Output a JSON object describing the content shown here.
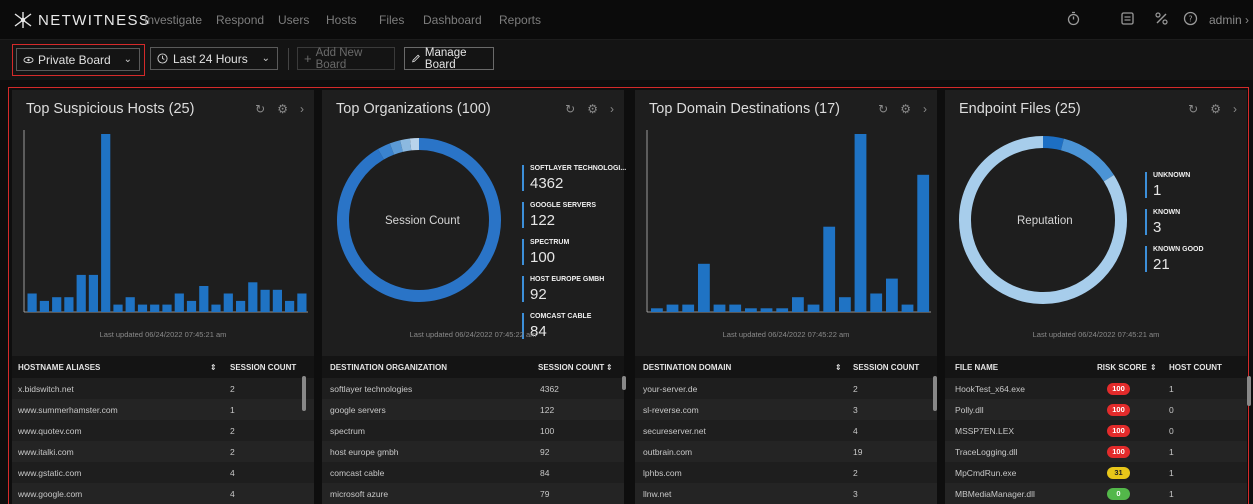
{
  "brand": {
    "name": "NETWITNESS"
  },
  "nav": {
    "items": [
      "Investigate",
      "Respond",
      "Users",
      "Hosts",
      "Files",
      "Dashboard",
      "Reports"
    ],
    "user": "admin"
  },
  "toolbar": {
    "board_label": "Private Board",
    "time_label": "Last 24 Hours",
    "add_label": "Add New Board",
    "manage_label": "Manage Board"
  },
  "colors": {
    "accent": "#1f73c4",
    "highlight": "#d42a2a",
    "panel": "#1e1e1e"
  },
  "dashlets": [
    {
      "title": "Top Suspicious Hosts (25)",
      "updated": "Last updated 06/24/2022 07:45:21 am",
      "columns": [
        "HOSTNAME ALIASES",
        "SESSION COUNT"
      ],
      "rows": [
        [
          "x.bidswitch.net",
          "2"
        ],
        [
          "www.summerhamster.com",
          "1"
        ],
        [
          "www.quotev.com",
          "2"
        ],
        [
          "www.italki.com",
          "2"
        ],
        [
          "www.gstatic.com",
          "4"
        ],
        [
          "www.google.com",
          "4"
        ]
      ]
    },
    {
      "title": "Top Organizations (100)",
      "updated": "Last updated 06/24/2022 07:45:22 am",
      "center_label": "Session Count",
      "legend": [
        {
          "name": "SOFTLAYER TECHNOLOGI...",
          "value": "4362"
        },
        {
          "name": "GOOGLE SERVERS",
          "value": "122"
        },
        {
          "name": "SPECTRUM",
          "value": "100"
        },
        {
          "name": "HOST EUROPE GMBH",
          "value": "92"
        },
        {
          "name": "COMCAST CABLE",
          "value": "84"
        }
      ],
      "columns": [
        "DESTINATION ORGANIZATION",
        "SESSION COUNT"
      ],
      "rows": [
        [
          "softlayer technologies",
          "4362"
        ],
        [
          "google servers",
          "122"
        ],
        [
          "spectrum",
          "100"
        ],
        [
          "host europe gmbh",
          "92"
        ],
        [
          "comcast cable",
          "84"
        ],
        [
          "microsoft azure",
          "79"
        ]
      ]
    },
    {
      "title": "Top Domain Destinations (17)",
      "updated": "Last updated 06/24/2022 07:45:22 am",
      "columns": [
        "DESTINATION DOMAIN",
        "SESSION COUNT"
      ],
      "rows": [
        [
          "your-server.de",
          "2"
        ],
        [
          "sl-reverse.com",
          "3"
        ],
        [
          "secureserver.net",
          "4"
        ],
        [
          "outbrain.com",
          "19"
        ],
        [
          "lphbs.com",
          "2"
        ],
        [
          "llnw.net",
          "3"
        ]
      ]
    },
    {
      "title": "Endpoint Files (25)",
      "updated": "Last updated 06/24/2022 07:45:21 am",
      "center_label": "Reputation",
      "legend": [
        {
          "name": "UNKNOWN",
          "value": "1"
        },
        {
          "name": "KNOWN",
          "value": "3"
        },
        {
          "name": "KNOWN GOOD",
          "value": "21"
        }
      ],
      "columns": [
        "FILE NAME",
        "RISK SCORE",
        "HOST COUNT"
      ],
      "rows": [
        [
          "HookTest_x64.exe",
          "100",
          "1"
        ],
        [
          "Polly.dll",
          "100",
          "0"
        ],
        [
          "MSSP7EN.LEX",
          "100",
          "0"
        ],
        [
          "TraceLogging.dll",
          "100",
          "1"
        ],
        [
          "MpCmdRun.exe",
          "31",
          "1"
        ],
        [
          "MBMediaManager.dll",
          "0",
          "1"
        ]
      ]
    }
  ],
  "chart_data": [
    {
      "type": "bar",
      "values": [
        5,
        3,
        4,
        4,
        10,
        10,
        48,
        2,
        4,
        2,
        2,
        2,
        5,
        3,
        7,
        2,
        5,
        3,
        8,
        6,
        6,
        3,
        5
      ]
    },
    {
      "type": "pie",
      "categories": [
        "SOFTLAYER TECHNOLOGI...",
        "GOOGLE SERVERS",
        "SPECTRUM",
        "HOST EUROPE GMBH",
        "COMCAST CABLE"
      ],
      "values": [
        4362,
        122,
        100,
        92,
        84
      ]
    },
    {
      "type": "bar",
      "values": [
        1,
        2,
        2,
        13,
        2,
        2,
        1,
        1,
        1,
        4,
        2,
        23,
        4,
        48,
        5,
        9,
        2,
        37
      ]
    },
    {
      "type": "pie",
      "categories": [
        "UNKNOWN",
        "KNOWN",
        "KNOWN GOOD"
      ],
      "values": [
        1,
        3,
        21
      ]
    }
  ]
}
